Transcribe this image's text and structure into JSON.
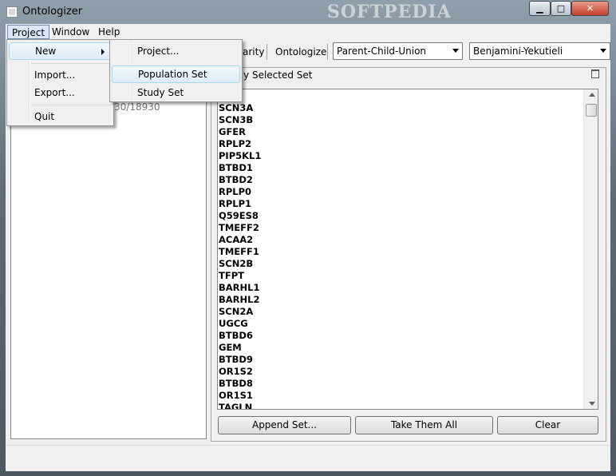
{
  "window": {
    "title": "Ontologizer",
    "watermark": "SOFTPEDIA",
    "controls": {
      "minimize": "▁",
      "maximize": "□",
      "close": "✕"
    }
  },
  "menubar": {
    "items": [
      "Project",
      "Window",
      "Help"
    ]
  },
  "toolbar": {
    "partial_text": "arity",
    "ontologize_label": "Ontologize",
    "calculation": "Parent-Child-Union",
    "correction": "Benjamini-Yekutieli"
  },
  "left_panel": {
    "count_text": "30/18930"
  },
  "right_panel": {
    "header": "tly Selected Set",
    "genes": [
      "SCN3A",
      "SCN3B",
      "GFER",
      "RPLP2",
      "PIP5KL1",
      "BTBD1",
      "BTBD2",
      "RPLP0",
      "RPLP1",
      "Q59ES8",
      "TMEFF2",
      "ACAA2",
      "TMEFF1",
      "SCN2B",
      "TFPT",
      "BARHL1",
      "BARHL2",
      "SCN2A",
      "UGCG",
      "BTBD6",
      "GEM",
      "BTBD9",
      "OR1S2",
      "BTBD8",
      "OR1S1",
      "TAGLN"
    ],
    "buttons": {
      "append": "Append Set...",
      "take_all": "Take Them All",
      "clear": "Clear"
    }
  },
  "project_menu": {
    "new": "New",
    "import": "Import...",
    "export": "Export...",
    "quit": "Quit"
  },
  "new_menu": {
    "project": "Project...",
    "population_set": "Population Set",
    "study_set": "Study Set"
  }
}
